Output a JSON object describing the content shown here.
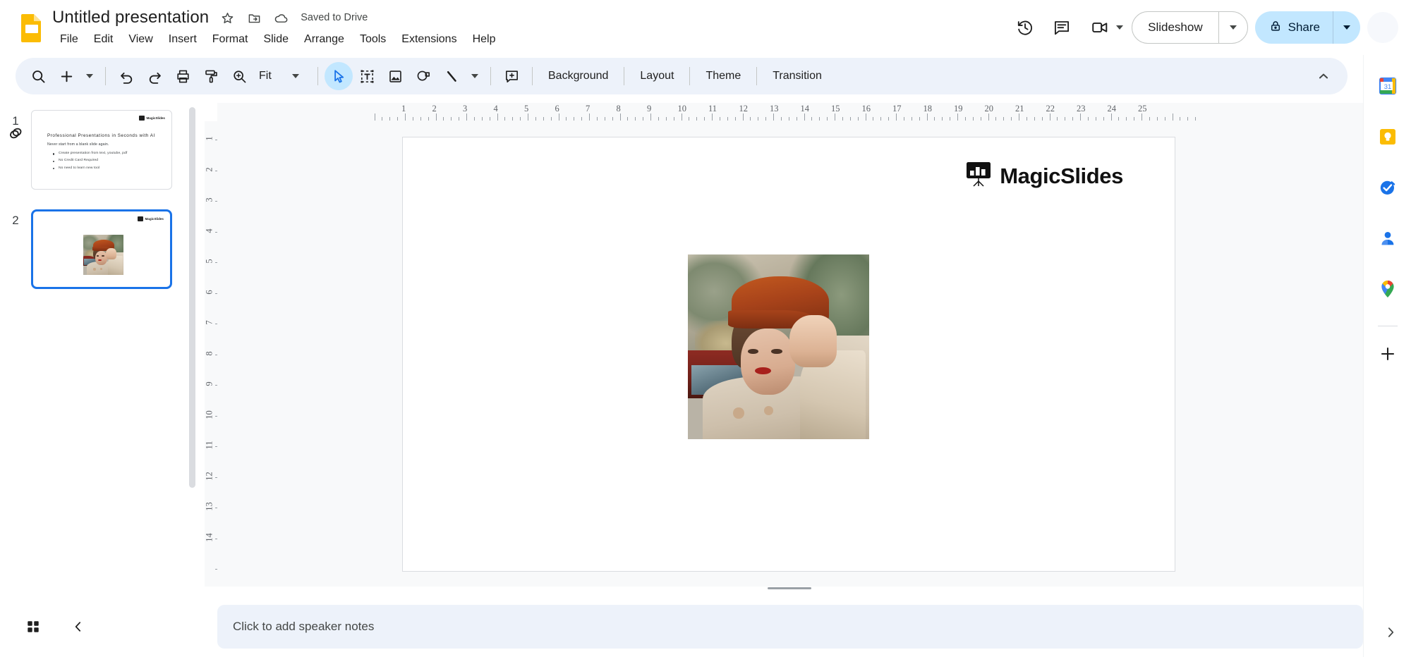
{
  "app": {
    "name": "Google Slides",
    "doc_title": "Untitled presentation",
    "save_status": "Saved to Drive"
  },
  "menubar": {
    "items": [
      {
        "label": "File"
      },
      {
        "label": "Edit"
      },
      {
        "label": "View"
      },
      {
        "label": "Insert"
      },
      {
        "label": "Format"
      },
      {
        "label": "Slide"
      },
      {
        "label": "Arrange"
      },
      {
        "label": "Tools"
      },
      {
        "label": "Extensions"
      },
      {
        "label": "Help"
      }
    ]
  },
  "title_actions": {
    "star": "star-icon",
    "move": "move-to-folder-icon",
    "cloud": "saved-cloud-icon"
  },
  "top_right": {
    "history_icon": "version-history-icon",
    "comment_icon": "comment-history-icon",
    "meet_icon": "google-meet-icon",
    "slideshow_label": "Slideshow",
    "share_label": "Share",
    "share_lock_icon": "lock-icon",
    "avatar": "account-avatar"
  },
  "toolbar": {
    "zoom_value": "Fit",
    "buttons": [
      {
        "name": "search-icon"
      },
      {
        "name": "new-slide-icon"
      },
      {
        "name": "undo-icon"
      },
      {
        "name": "redo-icon"
      },
      {
        "name": "print-icon"
      },
      {
        "name": "paint-format-icon"
      },
      {
        "name": "zoom-icon"
      },
      {
        "name": "select-cursor-icon"
      },
      {
        "name": "text-box-icon"
      },
      {
        "name": "insert-image-icon"
      },
      {
        "name": "shape-icon"
      },
      {
        "name": "line-icon"
      },
      {
        "name": "comment-icon"
      }
    ],
    "text_buttons": [
      {
        "label": "Background"
      },
      {
        "label": "Layout"
      },
      {
        "label": "Theme"
      },
      {
        "label": "Transition"
      }
    ],
    "collapse_icon": "collapse-toolbar-chevron-up-icon"
  },
  "filmstrip": {
    "slides": [
      {
        "number": "1",
        "selected": false,
        "has_transition": true,
        "logo_text": "MagicSlides",
        "title": "Professional Presentations in Seconds with AI",
        "subtitle": "Never start from a blank slide again.",
        "bullets": [
          "Create presentation from text, youtube, pdf",
          "No Credit Card Required",
          "No need to learn new tool"
        ]
      },
      {
        "number": "2",
        "selected": true,
        "has_transition": false,
        "logo_text": "MagicSlides",
        "has_image": true
      }
    ]
  },
  "rulers": {
    "horizontal_ticks": [
      "1",
      "2",
      "3",
      "4",
      "5",
      "6",
      "7",
      "8",
      "9",
      "10",
      "11",
      "12",
      "13",
      "14",
      "15",
      "16",
      "17",
      "18",
      "19",
      "20",
      "21",
      "22",
      "23",
      "24",
      "25"
    ],
    "vertical_ticks": [
      "1",
      "2",
      "3",
      "4",
      "5",
      "6",
      "7",
      "8",
      "9",
      "10",
      "11",
      "12",
      "13",
      "14"
    ]
  },
  "slide_canvas": {
    "logo_text": "MagicSlides",
    "logo_icon": "magicslides-easel-icon",
    "image_alt": "photo-of-woman-in-rust-hat-and-cream-coat"
  },
  "notes": {
    "placeholder": "Click to add speaker notes"
  },
  "bottom_bar": {
    "grid_view_icon": "filmstrip-grid-view-icon",
    "collapse_icon": "hide-filmstrip-chevron-left-icon"
  },
  "right_sidebar": {
    "items": [
      {
        "name": "google-calendar-icon",
        "label": "Calendar"
      },
      {
        "name": "google-keep-icon",
        "label": "Keep"
      },
      {
        "name": "google-tasks-icon",
        "label": "Tasks"
      },
      {
        "name": "google-contacts-icon",
        "label": "Contacts"
      },
      {
        "name": "google-maps-icon",
        "label": "Maps"
      },
      {
        "name": "add-on-plus-icon",
        "label": "Get Add-ons"
      }
    ],
    "expand_icon": "show-side-panel-chevron-right-icon"
  },
  "colors": {
    "accent_blue": "#1a73e8",
    "share_bg": "#c2e7ff",
    "toolbar_bg": "#edf2fa",
    "canvas_bg": "#f8f9fa",
    "logo_yellow": "#fbbc04"
  }
}
